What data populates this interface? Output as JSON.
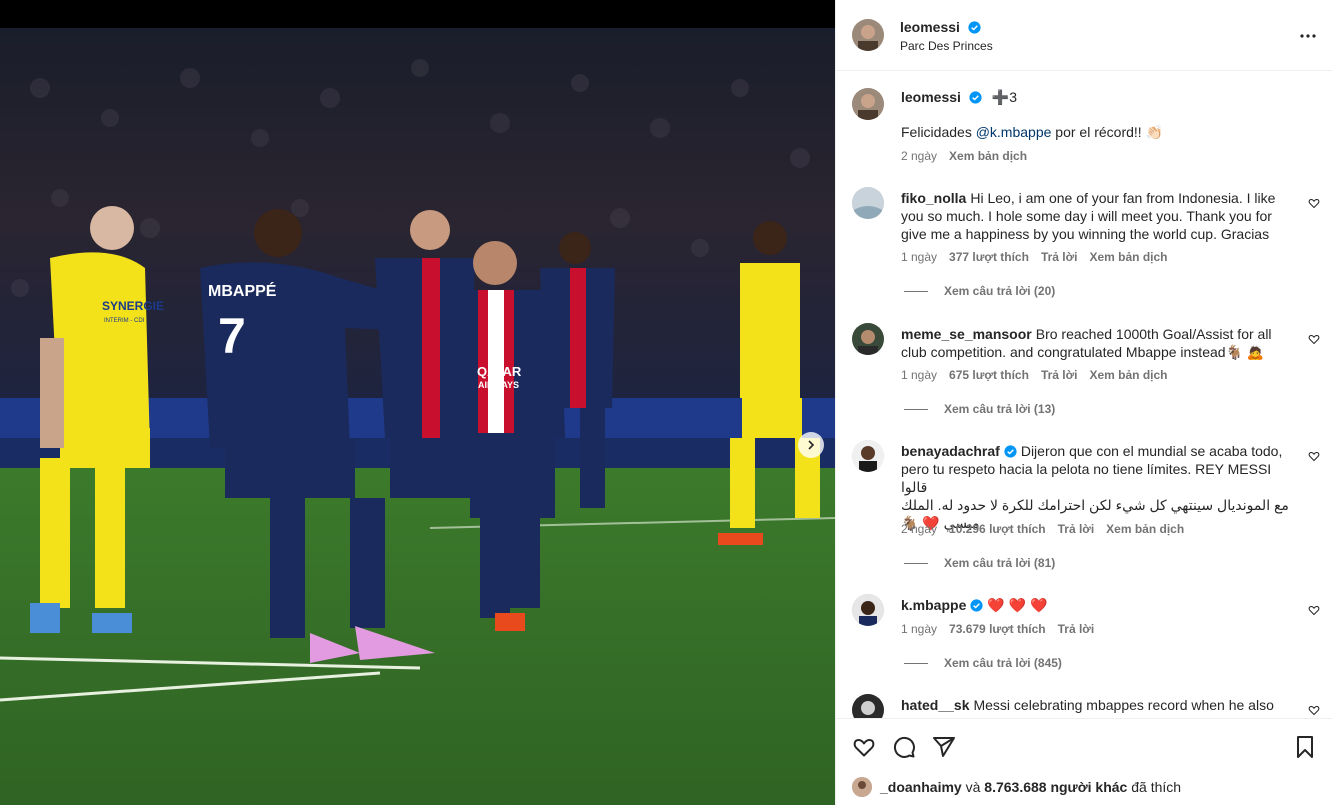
{
  "post": {
    "author": "leomessi",
    "location": "Parc Des Princes",
    "caption_author": "leomessi",
    "caption_badge": "➕3",
    "caption_prefix": "Felicidades ",
    "caption_mention": "@k.mbappe",
    "caption_suffix": " por el récord!! 👏🏻",
    "caption_time": "2 ngày",
    "caption_translate": "Xem bản dịch"
  },
  "photo": {
    "jersey_name": "MBAPPÉ",
    "jersey_number": "7",
    "sponsor_line1": "QATAR",
    "sponsor_line2": "AIRWAYS",
    "nantes_sponsor": "SYNERGIE",
    "nantes_sponsor_sub": "INTERIM - CDI"
  },
  "comments": [
    {
      "user": "fiko_nolla",
      "verified": false,
      "text": "Hi Leo, i am one of your fan from Indonesia. I like you so much. I hole some day i will meet you. Thank you for give me a happiness by you winning the world cup. Gracias",
      "time": "1 ngày",
      "likes": "377 lượt thích",
      "reply": "Trả lời",
      "translate": "Xem bản dịch",
      "view_replies": "Xem câu trả lời (20)"
    },
    {
      "user": "meme_se_mansoor",
      "verified": false,
      "text": "Bro reached 1000th Goal/Assist for all club competition. and congratulated Mbappe instead🐐 🙇",
      "time": "1 ngày",
      "likes": "675 lượt thích",
      "reply": "Trả lời",
      "translate": "Xem bản dịch",
      "view_replies": "Xem câu trả lời (13)"
    },
    {
      "user": "benayadachraf",
      "verified": true,
      "text_line1": "Dijeron que con el mundial se acaba todo,",
      "text_line2": "pero tu respeto hacia la pelota no tiene límites. REY MESSI قالوا",
      "text_line3": "مع المونديال سينتهي كل شيء لكن احترامك للكرة لا حدود له. الملك",
      "text_line4": "ميسي ❤️ 🐐",
      "time": "2 ngày",
      "likes": "10.296 lượt thích",
      "reply": "Trả lời",
      "translate": "Xem bản dịch",
      "view_replies": "Xem câu trả lời (81)"
    },
    {
      "user": "k.mbappe",
      "verified": true,
      "text": "❤️ ❤️ ❤️",
      "time": "1 ngày",
      "likes": "73.679 lượt thích",
      "reply": "Trả lời",
      "view_replies": "Xem câu trả lời (845)"
    },
    {
      "user": "hated__sk",
      "verified": false,
      "text": "Messi celebrating mbappes record when he also"
    }
  ],
  "likes_summary": {
    "user": "_doanhaimy",
    "connector": " và ",
    "count": "8.763.688 người khác",
    "suffix": " đã thích"
  },
  "colors": {
    "psg_navy": "#1b2a5c",
    "nantes_yellow": "#f3e21a",
    "pitch_green": "#3f7a2e",
    "verified_blue": "#0095f6",
    "heart_red": "#ed1c24"
  }
}
